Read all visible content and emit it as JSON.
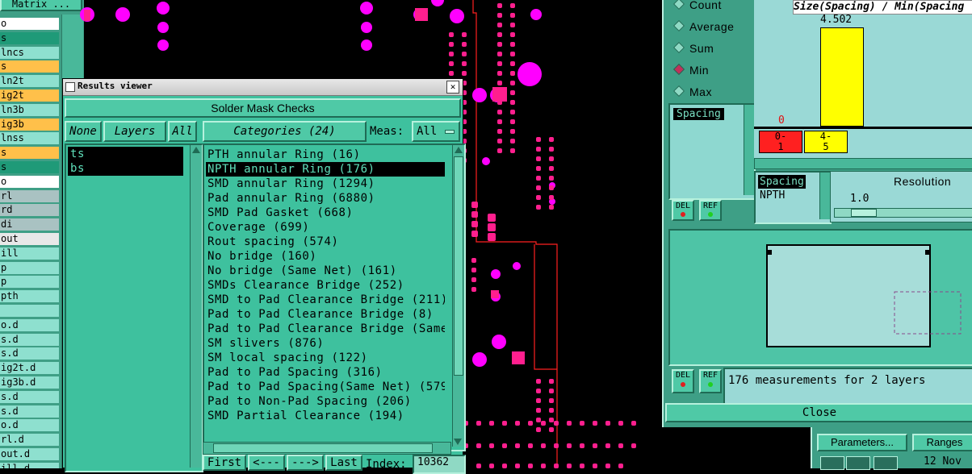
{
  "left_panel": {
    "header": "Matrix ...",
    "layers": [
      {
        "label": "o",
        "bg": "#ffffff"
      },
      {
        "label": "s",
        "bg": "#1f9a78"
      },
      {
        "label": "lncs",
        "bg": "#8ee0cf"
      },
      {
        "label": "s",
        "bg": "#ffc04a"
      },
      {
        "label": "ln2t",
        "bg": "#8ee0cf"
      },
      {
        "label": "ig2t",
        "bg": "#ffc04a"
      },
      {
        "label": "ln3b",
        "bg": "#8ee0cf"
      },
      {
        "label": "ig3b",
        "bg": "#ffc04a"
      },
      {
        "label": "lnss",
        "bg": "#8ee0cf"
      },
      {
        "label": "s",
        "bg": "#ffc04a"
      },
      {
        "label": "s",
        "bg": "#1f9a78"
      },
      {
        "label": "o",
        "bg": "#ffffff"
      },
      {
        "label": "rl",
        "bg": "#a9c2c2"
      },
      {
        "label": "rd",
        "bg": "#a9c2c2"
      },
      {
        "label": "di",
        "bg": "#a9c2c2"
      },
      {
        "label": "out",
        "bg": "#e8e8e8"
      },
      {
        "label": "ill",
        "bg": "#8ee0cf"
      },
      {
        "label": "p",
        "bg": "#8ee0cf"
      },
      {
        "label": "p",
        "bg": "#8ee0cf"
      },
      {
        "label": "pth",
        "bg": "#8ee0cf"
      },
      {
        "label": "",
        "bg": "#8ee0cf"
      },
      {
        "label": "o.d",
        "bg": "#8ee0cf"
      },
      {
        "label": "s.d",
        "bg": "#8ee0cf"
      },
      {
        "label": "s.d",
        "bg": "#8ee0cf"
      },
      {
        "label": "ig2t.d",
        "bg": "#8ee0cf"
      },
      {
        "label": "ig3b.d",
        "bg": "#8ee0cf"
      },
      {
        "label": "s.d",
        "bg": "#8ee0cf"
      },
      {
        "label": "s.d",
        "bg": "#8ee0cf"
      },
      {
        "label": "o.d",
        "bg": "#8ee0cf"
      },
      {
        "label": "rl.d",
        "bg": "#8ee0cf"
      },
      {
        "label": "out.d",
        "bg": "#8ee0cf"
      },
      {
        "label": "ill.d",
        "bg": "#8ee0cf"
      }
    ]
  },
  "results_viewer": {
    "title": "Results viewer",
    "close_glyph": "✕",
    "heading": "Solder Mask Checks",
    "none_label": "None",
    "layers_label": "Layers",
    "all_label": "All",
    "layers": [
      "ts",
      "bs"
    ],
    "categories_label": "Categories (24)",
    "meas_label": "Meas:",
    "meas_value": "All",
    "categories": [
      "PTH annular Ring (16)",
      "NPTH annular Ring (176)",
      "SMD annular Ring (1294)",
      "Pad annular Ring (6880)",
      "SMD Pad Gasket (668)",
      "Coverage (699)",
      "Rout spacing (574)",
      "No bridge (160)",
      "No bridge (Same Net) (161)",
      "SMDs Clearance Bridge (252)",
      "SMD to Pad Clearance Bridge (211)",
      "Pad to Pad Clearance Bridge (8)",
      "Pad to Pad Clearance Bridge (Same",
      "SM slivers (876)",
      "SM local spacing (122)",
      "Pad to Pad Spacing (316)",
      "Pad to Pad Spacing(Same Net) (579",
      "Pad to Non-Pad Spacing (206)",
      "SMD Partial Clearance (194)"
    ],
    "selected_category": 1,
    "nav": {
      "first": "First",
      "prev": "<---",
      "next": "--->",
      "last": "Last",
      "index_label": "Index:",
      "index_value": "10362"
    }
  },
  "right_panel": {
    "stats": [
      "Count",
      "Average",
      "Sum",
      "Min",
      "Max"
    ],
    "selected_stat": 3,
    "histogram_title": "Size(Spacing) / Min(Spacing",
    "histogram": {
      "bins": [
        {
          "label_top": "0-",
          "label_bottom": "1",
          "value": 0
        },
        {
          "label_top": "4-",
          "label_bottom": "5",
          "value": 4.502
        }
      ],
      "value_label": "4.502",
      "zero_label": "0"
    },
    "spacing_label": "Spacing",
    "del_label": "DEL",
    "ref_label": "REF",
    "spacing_items": [
      "Spacing",
      "NPTH"
    ],
    "resolution_label": "Resolution",
    "resolution_value": "1.0",
    "measurements_text": "176 measurements for 2 layers",
    "close_label": "Close",
    "parameters_label": "Parameters...",
    "ranges_label": "Ranges",
    "date_text": "12 Nov"
  }
}
